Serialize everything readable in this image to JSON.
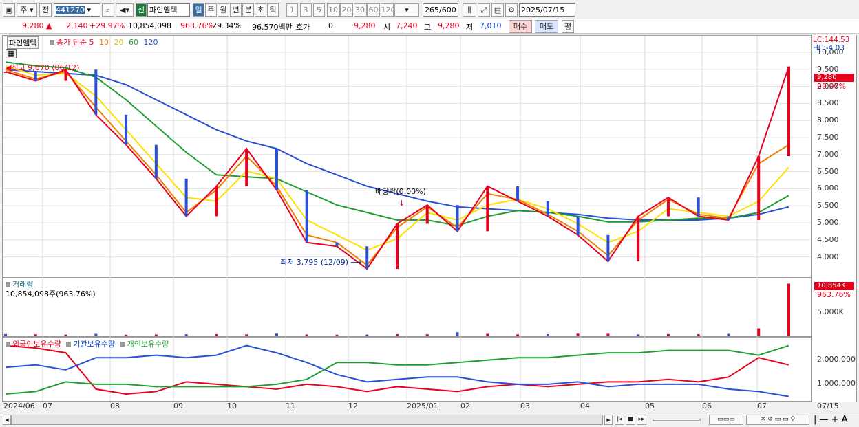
{
  "toolbar": {
    "mode": "주",
    "prev": "전",
    "code": "441270",
    "sign": "신",
    "name": "파인엠텍",
    "periods": [
      "일",
      "주",
      "월",
      "년",
      "분",
      "초",
      "틱"
    ],
    "intervals": [
      "1",
      "3",
      "5",
      "10",
      "20",
      "30",
      "60",
      "120"
    ],
    "count": "265",
    "count_total": "/600",
    "date": "2025/07/15"
  },
  "quote": {
    "price": "9,280",
    "change": "2,140",
    "change_pct": "+29.97%",
    "volume": "10,854,098",
    "vol_ratio": "963.76%",
    "turnover": "29.34%",
    "amount": "96,570백만",
    "hoga_label": "호가",
    "hoga_value": "0",
    "close_val": "9,280",
    "open_label": "시",
    "open_val": "7,240",
    "high_label": "고",
    "high_val": "9,280",
    "low_label": "저",
    "low_val": "7,010",
    "buy_btn": "매수",
    "sell_btn": "매도",
    "eval_btn": "평"
  },
  "price_pane": {
    "title": "파인엠텍",
    "ma_label": "종가 단순",
    "ma_periods": [
      "5",
      "10",
      "20",
      "60",
      "120"
    ],
    "high_note": "최고 9,670 (06/12)",
    "low_note": "최저 3,795 (12/09)",
    "div_note": "배당락(0.00%)",
    "lc": "LC:144.53",
    "hc": "HC:-4.03",
    "last_tag": "9,280",
    "pct_tag": "29.97%",
    "yticks": [
      "10,000",
      "9,500",
      "9,000",
      "8,500",
      "8,000",
      "7,500",
      "7,000",
      "6,500",
      "6,000",
      "5,500",
      "5,000",
      "4,500",
      "4,000"
    ]
  },
  "vol_pane": {
    "title": "거래량",
    "value": "10,854,098주(963.76%)",
    "tag": "10,854K",
    "pct": "963.76%",
    "ytick": "5,000K"
  },
  "holder_pane": {
    "legend": [
      "외국인보유수량",
      "기관보유수량",
      "개인보유수량"
    ],
    "yticks": [
      "2,000,000",
      "1,000,000"
    ]
  },
  "xlabels": [
    "2024/06",
    "07",
    "08",
    "09",
    "10",
    "11",
    "12",
    "2025/01",
    "02",
    "03",
    "04",
    "05",
    "06",
    "07",
    "07/15"
  ],
  "chart_data": [
    {
      "type": "line",
      "title": "파인엠텍",
      "x": [
        "2024/06",
        "2024/07",
        "2024/07",
        "2024/08",
        "2024/08",
        "2024/09",
        "2024/09",
        "2024/10",
        "2024/10",
        "2024/11",
        "2024/11",
        "2024/12",
        "2024/12",
        "2025/01",
        "2025/01",
        "2025/02",
        "2025/02",
        "2025/03",
        "2025/03",
        "2025/04",
        "2025/04",
        "2025/05",
        "2025/05",
        "2025/06",
        "2025/06",
        "2025/07",
        "2025/07/15"
      ],
      "series": [
        {
          "name": "종가",
          "color": "#e8001c",
          "values": [
            9150,
            8900,
            9200,
            8000,
            7200,
            6300,
            5300,
            6100,
            7100,
            6000,
            4600,
            4500,
            3900,
            5100,
            5600,
            4900,
            6100,
            5700,
            5300,
            4800,
            4100,
            5300,
            5800,
            5300,
            5200,
            6900,
            9280
          ]
        },
        {
          "name": "5",
          "color": "#f08000",
          "values": [
            9200,
            8950,
            9150,
            8200,
            7300,
            6400,
            5400,
            6000,
            6900,
            6100,
            4800,
            4600,
            4000,
            5000,
            5550,
            5000,
            5900,
            5750,
            5350,
            4900,
            4250,
            5200,
            5750,
            5350,
            5250,
            6700,
            7200
          ]
        },
        {
          "name": "20",
          "color": "#ffe000",
          "values": [
            9300,
            9050,
            9100,
            8500,
            7600,
            6700,
            5800,
            5700,
            6500,
            6300,
            5200,
            4800,
            4400,
            4700,
            5400,
            5200,
            5600,
            5750,
            5500,
            5100,
            4600,
            4900,
            5500,
            5400,
            5300,
            5700,
            6600
          ]
        },
        {
          "name": "60",
          "color": "#1e9e32",
          "values": [
            9400,
            9300,
            9250,
            9000,
            8400,
            7700,
            7000,
            6400,
            6350,
            6300,
            5950,
            5600,
            5400,
            5200,
            5200,
            5050,
            5300,
            5450,
            5400,
            5300,
            5150,
            5150,
            5200,
            5250,
            5250,
            5400,
            5850
          ]
        },
        {
          "name": "120",
          "color": "#2a4fd8",
          "values": [
            9200,
            9150,
            9100,
            9050,
            8800,
            8400,
            8000,
            7600,
            7300,
            7100,
            6700,
            6400,
            6100,
            5900,
            5700,
            5550,
            5500,
            5450,
            5400,
            5350,
            5250,
            5200,
            5200,
            5200,
            5250,
            5350,
            5550
          ]
        }
      ],
      "ylim": [
        3700,
        10100
      ],
      "annotations": [
        "최고 9,670 (06/12)",
        "최저 3,795 (12/09)",
        "배당락(0.00%)"
      ]
    },
    {
      "type": "bar",
      "title": "거래량",
      "values_k": [
        300,
        250,
        200,
        350,
        180,
        220,
        260,
        300,
        250,
        400,
        220,
        180,
        200,
        300,
        260,
        700,
        350,
        250,
        300,
        400,
        380,
        250,
        300,
        280,
        350,
        1500,
        10854
      ],
      "ylim": [
        0,
        11500
      ]
    },
    {
      "type": "line",
      "series": [
        {
          "name": "외국인보유수량",
          "color": "#e8001c",
          "values": [
            2600000,
            2500000,
            2300000,
            800000,
            600000,
            700000,
            1100000,
            1000000,
            900000,
            800000,
            1000000,
            900000,
            700000,
            900000,
            800000,
            700000,
            900000,
            1000000,
            900000,
            1000000,
            1100000,
            1100000,
            1200000,
            1100000,
            1300000,
            2100000,
            1800000
          ]
        },
        {
          "name": "기관보유수량",
          "color": "#2a4fd8",
          "values": [
            1700000,
            1800000,
            1600000,
            2100000,
            2100000,
            2200000,
            2100000,
            2200000,
            2600000,
            2300000,
            1900000,
            1400000,
            1100000,
            1200000,
            1300000,
            1300000,
            1100000,
            1000000,
            1000000,
            1100000,
            900000,
            1000000,
            1000000,
            1000000,
            800000,
            700000,
            500000
          ]
        },
        {
          "name": "개인보유수량",
          "color": "#1e9e32",
          "values": [
            600000,
            700000,
            1100000,
            1000000,
            1000000,
            900000,
            900000,
            900000,
            900000,
            1000000,
            1200000,
            1900000,
            1900000,
            1800000,
            1800000,
            1900000,
            2000000,
            2100000,
            2100000,
            2200000,
            2300000,
            2300000,
            2400000,
            2400000,
            2400000,
            2200000,
            2600000
          ]
        }
      ],
      "ylim": [
        400000,
        2900000
      ]
    }
  ]
}
